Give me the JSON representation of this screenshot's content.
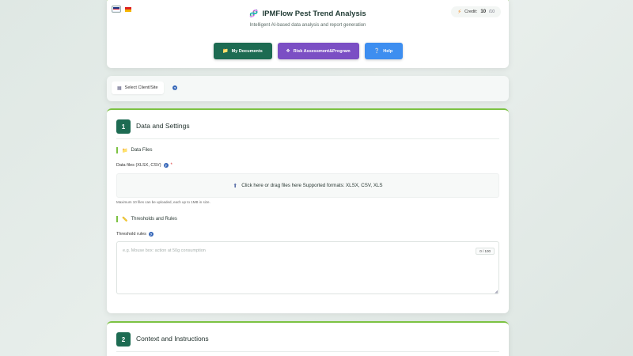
{
  "header": {
    "title": "IPMFlow Pest Trend Analysis",
    "subtitle": "Intelligent AI-based data analysis and report generation",
    "credit_label": "Credit:",
    "credit_value": "10",
    "credit_max": "/10",
    "buttons": {
      "documents": "My Documents",
      "risk": "Risk Assessment&Program",
      "help": "Help"
    },
    "colors": {
      "accent": "#7cc242",
      "primary": "#1d6b52",
      "purple": "#7b4fc4",
      "blue": "#3d8ef0"
    }
  },
  "client_bar": {
    "select_label": "Select Client/Site"
  },
  "section1": {
    "number": "1",
    "title": "Data and Settings",
    "data_files_heading": "Data Files",
    "data_files_label": "Data files (XLSX, CSV)",
    "required_mark": "*",
    "dropzone_text": "Click here or drag files here Supported formats: XLSX, CSV, XLS",
    "upload_hint": "Maximum 10 files can be uploaded, each up to 1MB in size.",
    "thresholds_heading": "Thresholds and Rules",
    "threshold_label": "Threshold rules",
    "threshold_placeholder": "e.g. Mouse box: action at 50g consumption",
    "threshold_value": "",
    "char_counter": "0 / 100"
  },
  "section2": {
    "number": "2",
    "title": "Context and Instructions"
  },
  "icons": {
    "logo": "dna-icon",
    "credit": "bolt-icon",
    "documents": "folder-icon",
    "risk": "shield-icon",
    "help": "question-icon",
    "client": "building-icon",
    "files": "folder-icon",
    "upload": "upload-icon",
    "thresholds": "ruler-icon"
  }
}
